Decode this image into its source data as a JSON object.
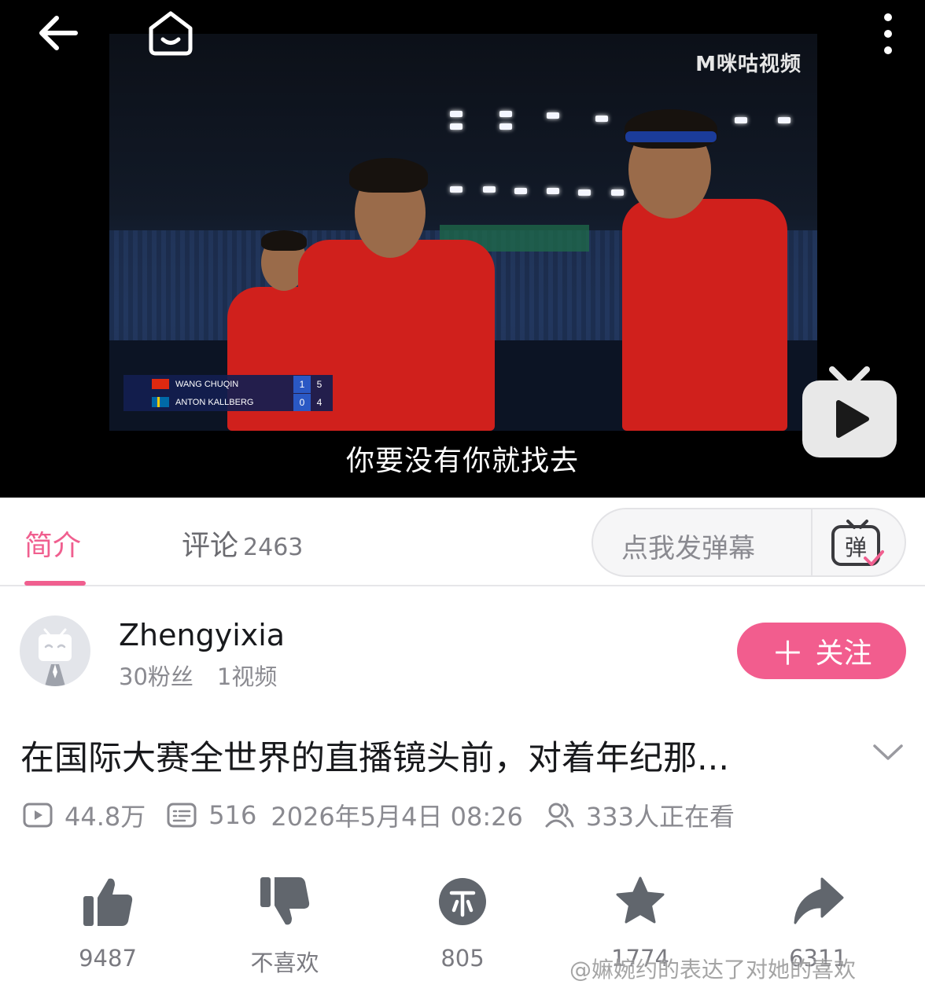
{
  "player": {
    "channel_logo": "M咪咕视频",
    "subtitle": "你要没有你就找去",
    "scoreboard": [
      {
        "name": "WANG CHUQIN",
        "games": "1",
        "points": "5"
      },
      {
        "name": "ANTON KALLBERG",
        "games": "0",
        "points": "4"
      }
    ]
  },
  "tabs": [
    {
      "label": "简介",
      "count": "",
      "active": true
    },
    {
      "label": "评论",
      "count": "2463",
      "active": false
    }
  ],
  "danmaku": {
    "placeholder": "点我发弹幕",
    "toggle_label": "弹"
  },
  "uploader": {
    "name": "Zhengyixia",
    "fans": "30粉丝",
    "videos": "1视频",
    "follow_label": "关注"
  },
  "video": {
    "title": "在国际大赛全世界的直播镜头前，对着年纪那...",
    "views": "44.8万",
    "danmaku_count": "516",
    "date": "2026年5月4日 08:26",
    "watching": "333人正在看"
  },
  "actions": [
    {
      "icon": "thumbs-up-icon",
      "label": "9487"
    },
    {
      "icon": "thumbs-down-icon",
      "label": "不喜欢"
    },
    {
      "icon": "coin-icon",
      "label": "805"
    },
    {
      "icon": "star-icon",
      "label": "1774"
    },
    {
      "icon": "share-icon",
      "label": "6311"
    }
  ],
  "weibo_watermark": "@嫲婉约的表达了对她的喜欢",
  "colors": {
    "accent": "#f25d8e",
    "tab_active": "#f05f8f",
    "text_primary": "#18191c",
    "text_secondary": "#8a8a90"
  }
}
